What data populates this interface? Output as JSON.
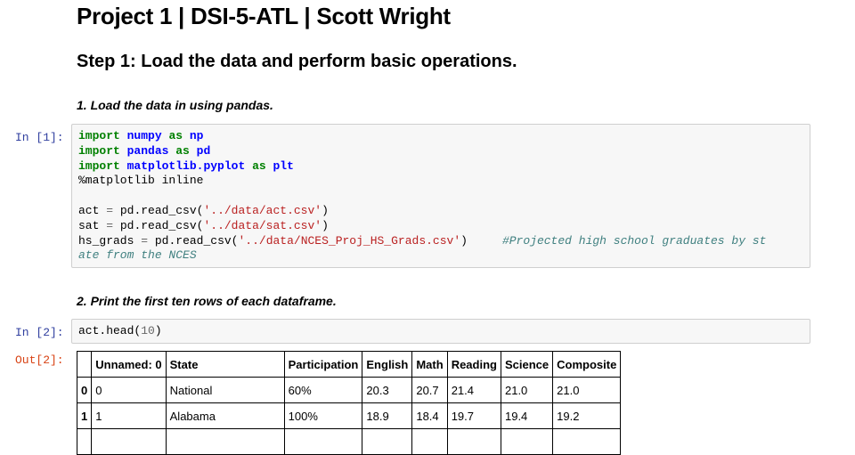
{
  "title": "Project 1 | DSI-5-ATL | Scott Wright",
  "step1_heading": "Step 1: Load the data and perform basic operations.",
  "instruction_1": "1. Load the data in using pandas.",
  "instruction_2": "2. Print the first ten rows of each dataframe.",
  "cell1": {
    "prompt": "In [1]:",
    "lines": {
      "l1": {
        "kw": "import",
        "mod": "numpy",
        "as": "as",
        "alias": "np"
      },
      "l2": {
        "kw": "import",
        "mod": "pandas",
        "as": "as",
        "alias": "pd"
      },
      "l3": {
        "kw": "import",
        "mod": "matplotlib.pyplot",
        "as": "as",
        "alias": "plt"
      },
      "l4": "%matplotlib inline",
      "l6": {
        "var": "act",
        "call": "pd.read_csv(",
        "arg": "'../data/act.csv'",
        "close": ")"
      },
      "l7": {
        "var": "sat",
        "call": "pd.read_csv(",
        "arg": "'../data/sat.csv'",
        "close": ")"
      },
      "l8": {
        "var": "hs_grads",
        "call": "pd.read_csv(",
        "arg": "'../data/NCES_Proj_HS_Grads.csv'",
        "close": ")",
        "comment": "#Projected high school graduates by st"
      },
      "l9": {
        "comment": "ate from the NCES"
      }
    }
  },
  "cell2": {
    "prompt": "In [2]:",
    "code_obj": "act.head(",
    "code_num": "10",
    "code_close": ")",
    "out_prompt": "Out[2]:"
  },
  "table": {
    "columns": [
      "",
      "Unnamed: 0",
      "State",
      "Participation",
      "English",
      "Math",
      "Reading",
      "Science",
      "Composite"
    ],
    "rows": [
      [
        "0",
        "0",
        "National",
        "60%",
        "20.3",
        "20.7",
        "21.4",
        "21.0",
        "21.0"
      ],
      [
        "1",
        "1",
        "Alabama",
        "100%",
        "18.9",
        "18.4",
        "19.7",
        "19.4",
        "19.2"
      ]
    ]
  }
}
